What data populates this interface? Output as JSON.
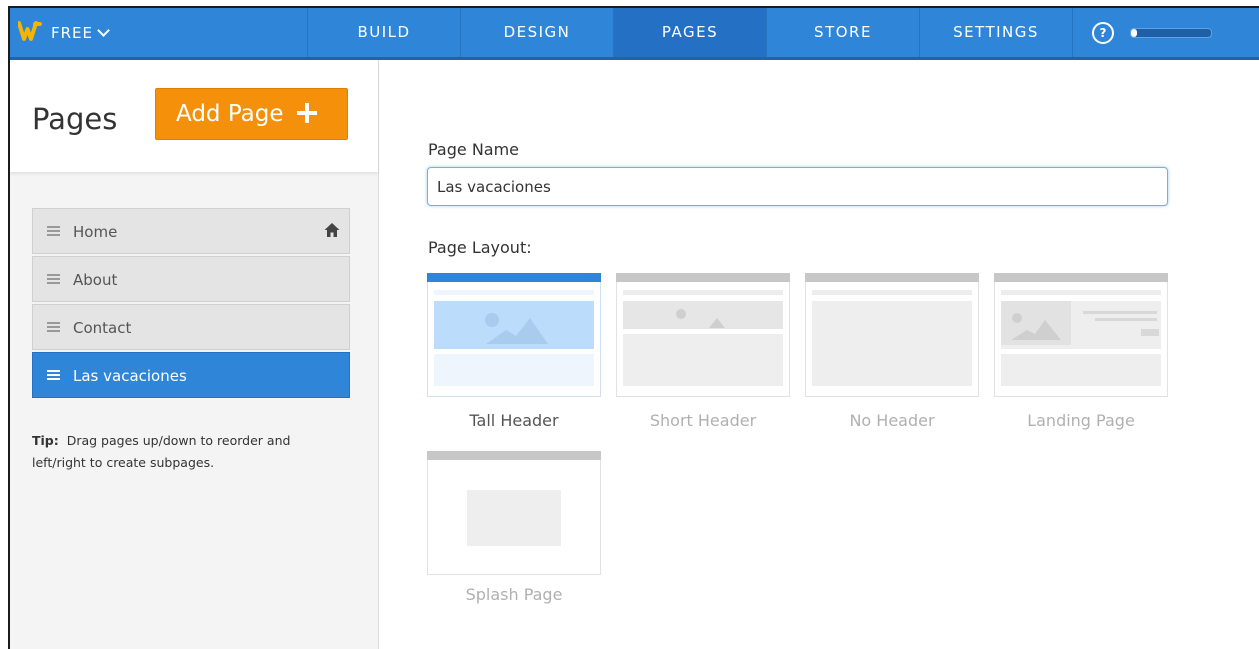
{
  "topbar": {
    "plan": "FREE",
    "tabs": [
      "BUILD",
      "DESIGN",
      "PAGES",
      "STORE",
      "SETTINGS"
    ],
    "active_tab": "PAGES",
    "help": "?",
    "progress_fraction": 0.08
  },
  "sidebar": {
    "title": "Pages",
    "add_page_label": "Add Page",
    "pages": [
      {
        "label": "Home",
        "is_home": true
      },
      {
        "label": "About"
      },
      {
        "label": "Contact"
      },
      {
        "label": "Las vacaciones",
        "selected": true
      }
    ],
    "tip_bold": "Tip:",
    "tip_text": "Drag pages up/down to reorder and left/right to create subpages."
  },
  "main": {
    "page_name_label": "Page Name",
    "page_name_value": "Las vacaciones",
    "layout_label": "Page Layout:",
    "layouts": [
      "Tall Header",
      "Short Header",
      "No Header",
      "Landing Page",
      "Splash Page"
    ],
    "selected_layout": "Tall Header"
  },
  "colors": {
    "brand_blue": "#2f86d9",
    "accent_orange": "#f5900a",
    "logo_yellow": "#f5b400"
  }
}
